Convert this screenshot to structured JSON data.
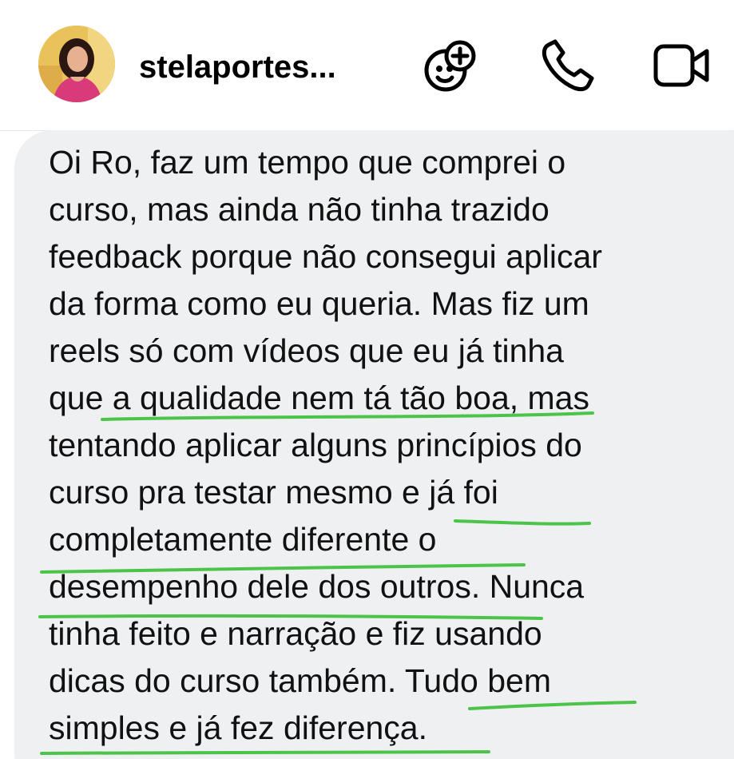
{
  "header": {
    "contact_name": "stelaportes...",
    "icons": {
      "avatar": "profile-photo",
      "effects": "face-plus-icon",
      "call": "phone-icon",
      "video": "video-camera-icon"
    }
  },
  "message": {
    "lines": [
      "Oi Ro, faz um tempo que comprei o",
      "curso, mas ainda não tinha trazido",
      "feedback porque não consegui aplicar",
      "da forma como eu queria. Mas fiz um",
      "reels só com vídeos que eu já tinha",
      "que a qualidade nem tá tão boa, mas",
      "tentando aplicar alguns princípios do",
      "curso pra testar mesmo e já foi",
      "completamente diferente o",
      "desempenho dele dos outros. Nunca",
      "tinha feito e narração e fiz usando",
      "dicas do curso também. Tudo bem",
      "simples e já fez diferença."
    ]
  },
  "colors": {
    "bubble": "#eff0f2",
    "text": "#111111",
    "highlight": "#4cc44a"
  }
}
